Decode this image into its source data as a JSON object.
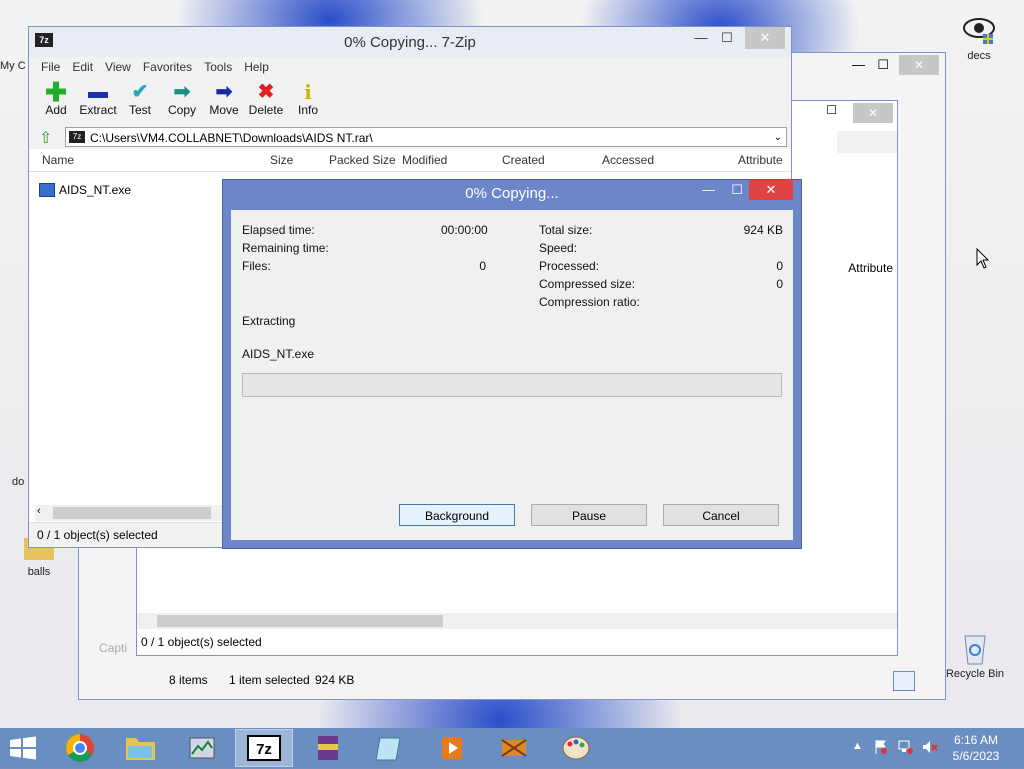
{
  "desktop": {
    "icons": [
      {
        "label": "decs",
        "name": "decs-icon"
      },
      {
        "label": "balls",
        "name": "balls-folder-icon"
      },
      {
        "label": "Recycle Bin",
        "name": "recycle-bin-icon"
      },
      {
        "label": "My C",
        "name": "my-computer-icon"
      },
      {
        "label": "do",
        "name": "doc-icon"
      }
    ]
  },
  "bg_explorer": {
    "col_attribute": "Attribute",
    "status_selected": "0 / 1 object(s) selected",
    "items_count": "8 items",
    "item_selected": "1 item selected",
    "item_size": "924 KB",
    "caption_partial": "Capti"
  },
  "zip": {
    "title": "0% Copying... 7-Zip",
    "menu": [
      "File",
      "Edit",
      "View",
      "Favorites",
      "Tools",
      "Help"
    ],
    "toolbar": [
      {
        "label": "Add",
        "icon": "add-icon"
      },
      {
        "label": "Extract",
        "icon": "extract-icon"
      },
      {
        "label": "Test",
        "icon": "test-icon"
      },
      {
        "label": "Copy",
        "icon": "copy-icon"
      },
      {
        "label": "Move",
        "icon": "move-icon"
      },
      {
        "label": "Delete",
        "icon": "delete-icon"
      },
      {
        "label": "Info",
        "icon": "info-icon"
      }
    ],
    "address": "C:\\Users\\VM4.COLLABNET\\Downloads\\AIDS NT.rar\\",
    "columns": [
      "Name",
      "Size",
      "Packed Size",
      "Modified",
      "Created",
      "Accessed",
      "Attribute"
    ],
    "files": [
      {
        "name": "AIDS_NT.exe"
      }
    ],
    "status": "0 / 1 object(s) selected"
  },
  "dialog": {
    "title": "0% Copying...",
    "elapsed_label": "Elapsed time:",
    "elapsed_value": "00:00:00",
    "remaining_label": "Remaining time:",
    "files_label": "Files:",
    "files_value": "0",
    "total_label": "Total size:",
    "total_value": "924 KB",
    "speed_label": "Speed:",
    "processed_label": "Processed:",
    "processed_value": "0",
    "compressed_label": "Compressed size:",
    "compressed_value": "0",
    "ratio_label": "Compression ratio:",
    "action": "Extracting",
    "current_file": "AIDS_NT.exe",
    "progress": 0,
    "buttons": {
      "background": "Background",
      "pause": "Pause",
      "cancel": "Cancel"
    }
  },
  "taskbar": {
    "time": "6:16 AM",
    "date": "5/6/2023",
    "apps": [
      "chrome",
      "file-explorer",
      "task-manager",
      "7zip",
      "winrar",
      "notepad",
      "media-player",
      "video-editor",
      "paint"
    ]
  },
  "colors": {
    "dialog_frame": "#6b86c9",
    "taskbar": "#6a8ec2",
    "close_red": "#e04343"
  }
}
